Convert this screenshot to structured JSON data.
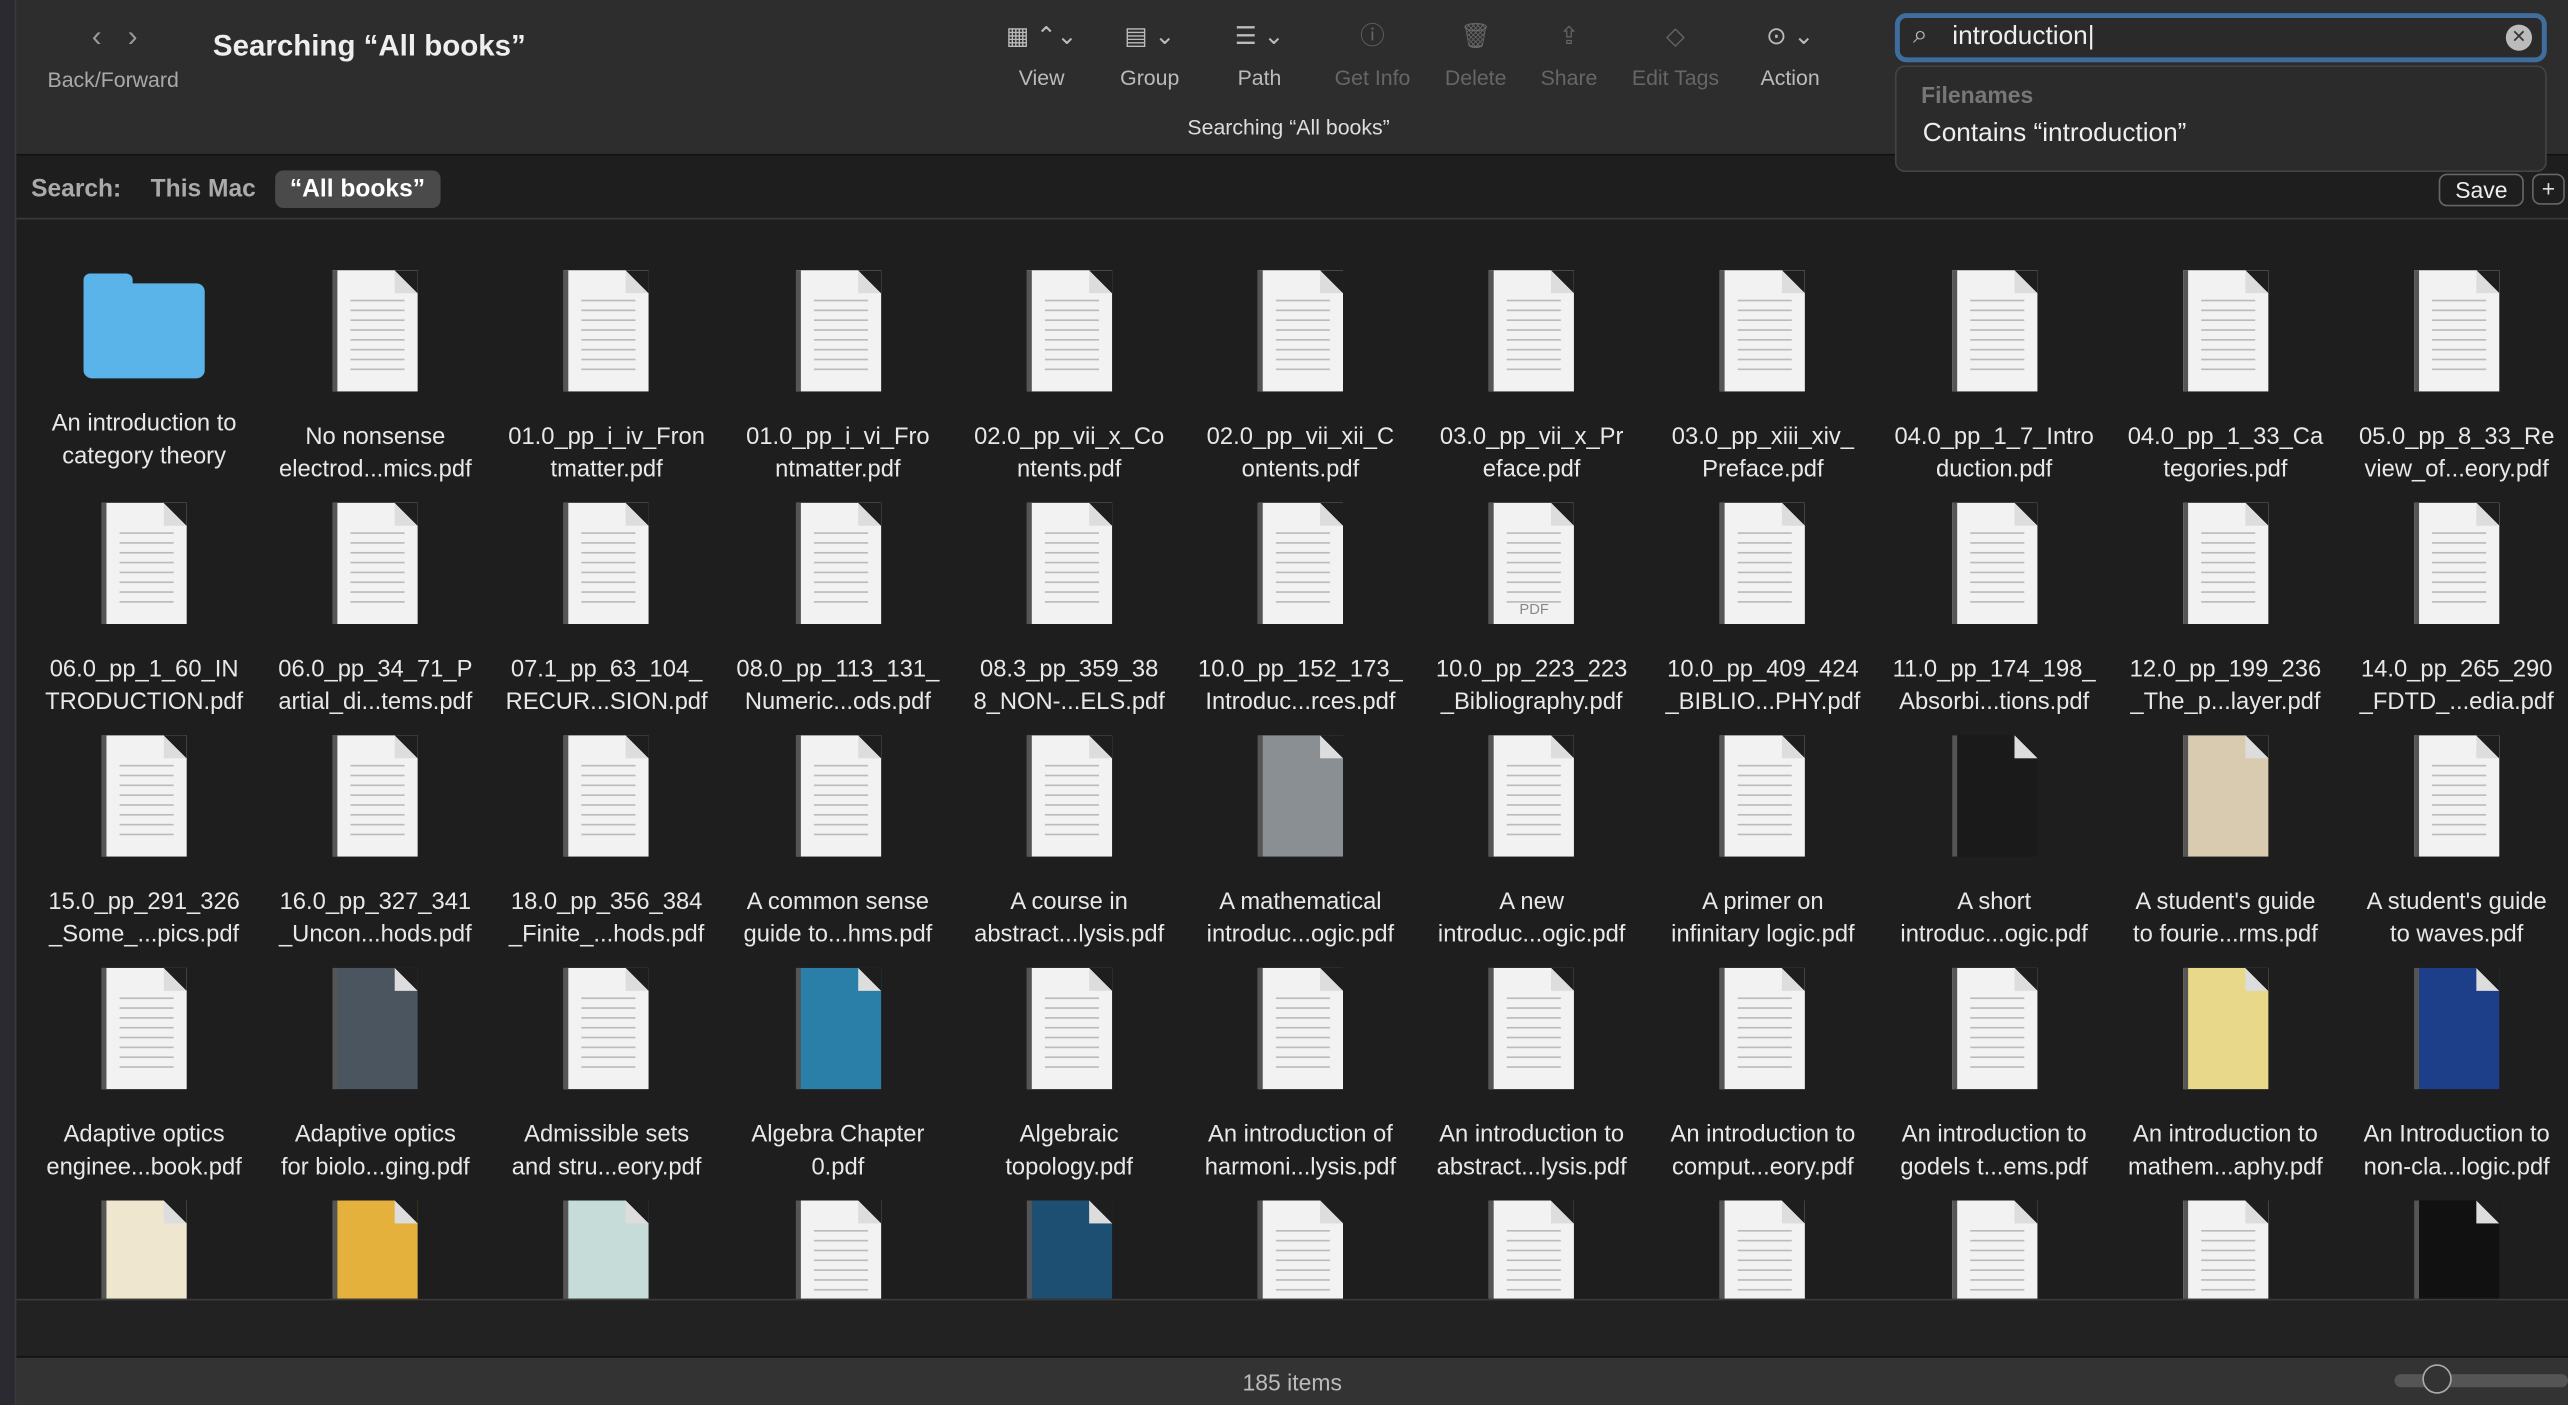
{
  "toolbar": {
    "back_forward_label": "Back/Forward",
    "title": "Searching “All books”",
    "subtitle": "Searching “All books”",
    "buttons": [
      {
        "label": "View",
        "icon": "grid-icon",
        "glyph": "▦ ⌃⌄"
      },
      {
        "label": "Group",
        "icon": "group-icon",
        "glyph": "▤ ⌄"
      },
      {
        "label": "Path",
        "icon": "path-icon",
        "glyph": "☰ ⌄"
      },
      {
        "label": "Get Info",
        "icon": "info-icon",
        "glyph": "ⓘ",
        "disabled": true
      },
      {
        "label": "Delete",
        "icon": "trash-icon",
        "glyph": "🗑",
        "disabled": true
      },
      {
        "label": "Share",
        "icon": "share-icon",
        "glyph": "⇪",
        "disabled": true
      },
      {
        "label": "Edit Tags",
        "icon": "tag-icon",
        "glyph": "◇",
        "disabled": true
      },
      {
        "label": "Action",
        "icon": "ellipsis-circle-icon",
        "glyph": "⊙ ⌄"
      }
    ]
  },
  "search": {
    "value": "introduction",
    "suggestion_header": "Filenames",
    "suggestion": "Contains “introduction”"
  },
  "scope": {
    "label": "Search:",
    "this_mac": "This Mac",
    "all_books": "“All books”",
    "save": "Save",
    "add": "+"
  },
  "status": {
    "count": "185 items",
    "icon_size": 0.2
  },
  "items": [
    {
      "l1": "An introduction to",
      "l2": "category theory",
      "type": "folder"
    },
    {
      "l1": "No nonsense",
      "l2": "electrod...mics.pdf"
    },
    {
      "l1": "01.0_pp_i_iv_Fron",
      "l2": "tmatter.pdf"
    },
    {
      "l1": "01.0_pp_i_vi_Fro",
      "l2": "ntmatter.pdf"
    },
    {
      "l1": "02.0_pp_vii_x_Co",
      "l2": "ntents.pdf"
    },
    {
      "l1": "02.0_pp_vii_xii_C",
      "l2": "ontents.pdf"
    },
    {
      "l1": "03.0_pp_vii_x_Pr",
      "l2": "eface.pdf"
    },
    {
      "l1": "03.0_pp_xiii_xiv_",
      "l2": "Preface.pdf"
    },
    {
      "l1": "04.0_pp_1_7_Intro",
      "l2": "duction.pdf"
    },
    {
      "l1": "04.0_pp_1_33_Ca",
      "l2": "tegories.pdf"
    },
    {
      "l1": "05.0_pp_8_33_Re",
      "l2": "view_of...eory.pdf"
    },
    {
      "l1": "06.0_pp_1_60_IN",
      "l2": "TRODUCTION.pdf"
    },
    {
      "l1": "06.0_pp_34_71_P",
      "l2": "artial_di...tems.pdf"
    },
    {
      "l1": "07.1_pp_63_104_",
      "l2": "RECUR...SION.pdf"
    },
    {
      "l1": "08.0_pp_113_131_",
      "l2": "Numeric...ods.pdf"
    },
    {
      "l1": "08.3_pp_359_38",
      "l2": "8_NON-...ELS.pdf"
    },
    {
      "l1": "10.0_pp_152_173_",
      "l2": "Introduc...rces.pdf"
    },
    {
      "l1": "10.0_pp_223_223",
      "l2": "_Bibliography.pdf",
      "badge": "PDF"
    },
    {
      "l1": "10.0_pp_409_424",
      "l2": "_BIBLIO...PHY.pdf"
    },
    {
      "l1": "11.0_pp_174_198_",
      "l2": "Absorbi...tions.pdf"
    },
    {
      "l1": "12.0_pp_199_236",
      "l2": "_The_p...layer.pdf"
    },
    {
      "l1": "14.0_pp_265_290",
      "l2": "_FDTD_...edia.pdf"
    },
    {
      "l1": "15.0_pp_291_326",
      "l2": "_Some_...pics.pdf"
    },
    {
      "l1": "16.0_pp_327_341",
      "l2": "_Uncon...hods.pdf"
    },
    {
      "l1": "18.0_pp_356_384",
      "l2": "_Finite_...hods.pdf"
    },
    {
      "l1": "A common sense",
      "l2": "guide to...hms.pdf"
    },
    {
      "l1": "A course in",
      "l2": "abstract...lysis.pdf"
    },
    {
      "l1": "A mathematical",
      "l2": "introduc...ogic.pdf",
      "cover": "#8a8f94"
    },
    {
      "l1": "A new",
      "l2": "introduc...ogic.pdf"
    },
    {
      "l1": "A primer on",
      "l2": "infinitary logic.pdf"
    },
    {
      "l1": "A short",
      "l2": "introduc...ogic.pdf",
      "cover": "#1a1a1a"
    },
    {
      "l1": "A student's guide",
      "l2": "to fourie...rms.pdf",
      "cover": "#d8cbb0"
    },
    {
      "l1": "A student's guide",
      "l2": "to waves.pdf"
    },
    {
      "l1": "Adaptive optics",
      "l2": "enginee...book.pdf"
    },
    {
      "l1": "Adaptive optics",
      "l2": "for biolo...ging.pdf",
      "cover": "#4a5560"
    },
    {
      "l1": "Admissible sets",
      "l2": "and stru...eory.pdf"
    },
    {
      "l1": "Algebra Chapter",
      "l2": "0.pdf",
      "cover": "#2a7fa8"
    },
    {
      "l1": "Algebraic",
      "l2": "topology.pdf"
    },
    {
      "l1": "An introduction of",
      "l2": "harmoni...lysis.pdf"
    },
    {
      "l1": "An introduction to",
      "l2": "abstract...lysis.pdf"
    },
    {
      "l1": "An introduction to",
      "l2": "comput...eory.pdf"
    },
    {
      "l1": "An introduction to",
      "l2": "godels t...ems.pdf"
    },
    {
      "l1": "An introduction to",
      "l2": "mathem...aphy.pdf",
      "cover": "#e8d88a"
    },
    {
      "l1": "An Introduction to",
      "l2": "non-cla...logic.pdf",
      "cover": "#1d3f8a"
    },
    {
      "cover": "#eee6cf"
    },
    {
      "cover": "#e3b13c"
    },
    {
      "cover": "#c5dcd8"
    },
    {},
    {
      "cover": "#1d4f73"
    },
    {},
    {},
    {},
    {},
    {},
    {
      "cover": "#111111"
    }
  ]
}
